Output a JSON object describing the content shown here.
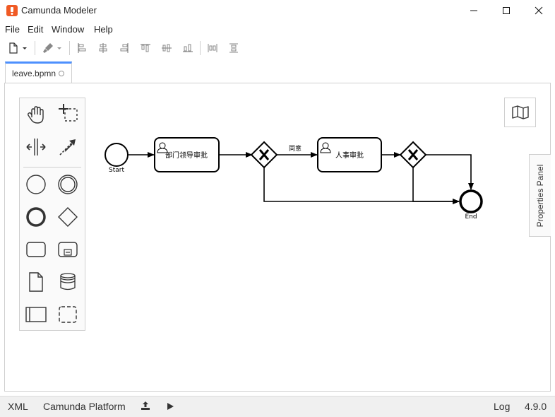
{
  "window": {
    "title": "Camunda Modeler",
    "accent_color": "#f05a24"
  },
  "menu": {
    "items": [
      "File",
      "Edit",
      "Window",
      "Help"
    ]
  },
  "toolbar": {
    "icons": [
      "new-file-icon",
      "dropdown-icon",
      "color-brush-icon",
      "align-left-icon",
      "align-center-icon",
      "align-right-icon",
      "align-top-icon",
      "align-middle-icon",
      "align-bottom-icon",
      "distribute-horizontal-icon",
      "distribute-vertical-icon"
    ]
  },
  "tabs": [
    {
      "label": "leave.bpmn",
      "active": true,
      "unsaved": false
    }
  ],
  "palette": {
    "tools": [
      "hand-tool",
      "lasso-tool",
      "space-tool",
      "global-connect-tool",
      "create-start-event",
      "create-intermediate-event",
      "create-end-event",
      "create-gateway",
      "create-task",
      "create-subprocess",
      "create-data-object",
      "create-data-store",
      "create-pool",
      "create-group"
    ]
  },
  "diagram": {
    "start_label": "Start",
    "end_label": "End",
    "task1_label": "部门领导审批",
    "task2_label": "人事审批",
    "flow_agree_label": "同意"
  },
  "properties_panel": {
    "label": "Properties Panel"
  },
  "status_bar": {
    "xml": "XML",
    "platform": "Camunda Platform",
    "log": "Log",
    "version": "4.9.0"
  }
}
